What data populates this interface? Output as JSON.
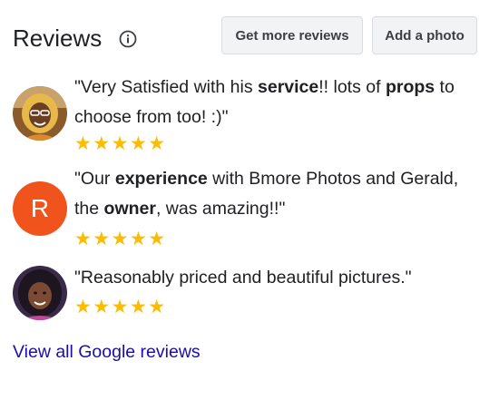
{
  "header": {
    "title": "Reviews",
    "get_more_label": "Get more reviews",
    "add_photo_label": "Add a photo"
  },
  "reviews": [
    {
      "avatar": "user-photo-1",
      "parts": [
        {
          "t": "\"Very Satisfied with his ",
          "b": false
        },
        {
          "t": "service",
          "b": true
        },
        {
          "t": "!! lots of ",
          "b": false
        },
        {
          "t": "props",
          "b": true
        },
        {
          "t": " to choose from too! :)\"",
          "b": false
        }
      ],
      "stars": "★★★★★",
      "rating": 5
    },
    {
      "avatar_letter": "R",
      "parts": [
        {
          "t": "\"Our ",
          "b": false
        },
        {
          "t": "experience",
          "b": true
        },
        {
          "t": " with Bmore Photos and Gerald, the ",
          "b": false
        },
        {
          "t": "owner",
          "b": true
        },
        {
          "t": ", was amazing!!\"",
          "b": false
        }
      ],
      "stars": "★★★★★",
      "rating": 5
    },
    {
      "avatar": "user-photo-3",
      "parts": [
        {
          "t": "\"Reasonably priced and beautiful pictures.\"",
          "b": false
        }
      ],
      "stars": "★★★★★",
      "rating": 5
    }
  ],
  "footer": {
    "view_all_label": "View all Google reviews"
  },
  "colors": {
    "star": "#fbbc04",
    "link": "#1a0dab",
    "letter_avatar_bg": "#f0531c"
  }
}
